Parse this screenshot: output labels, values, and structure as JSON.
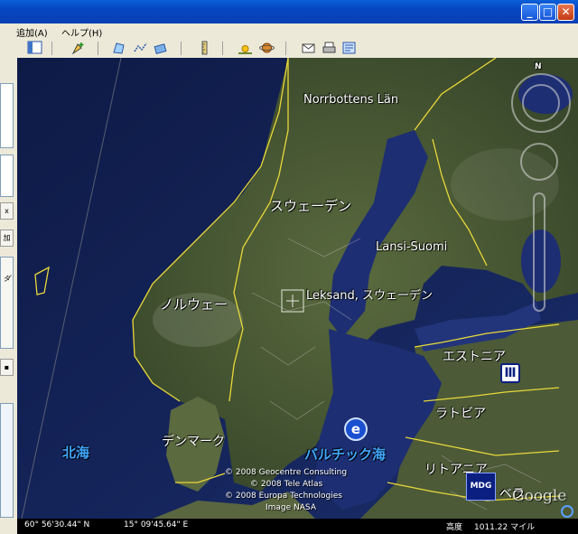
{
  "menu": {
    "items": [
      {
        "label": "追加(A)"
      },
      {
        "label": "ヘルプ(H)"
      }
    ]
  },
  "toolbar": {
    "icons": [
      "sidebar-toggle-icon",
      "placemark-icon",
      "polygon-icon",
      "path-icon",
      "overlay-icon",
      "ruler-icon",
      "sunlight-icon",
      "planet-icon",
      "email-icon",
      "print-icon",
      "map-view-icon"
    ]
  },
  "sidebar": {
    "buttons": [
      {
        "label": "x"
      },
      {
        "label": "加"
      },
      {
        "label": "ダ"
      }
    ]
  },
  "map": {
    "compass_north": "N",
    "labels": {
      "norrbottens": "Norrbottens Län",
      "sweden": "スウェーデン",
      "lansi_suomi": "Lansi-Suomi",
      "norway": "ノルウェー",
      "leksand": "Leksand, スウェーデン",
      "estonia": "エストニア",
      "latvia": "ラトビア",
      "lithuania": "リトアニア",
      "denmark": "デンマーク",
      "north_sea": "北海",
      "baltic_sea": "バルチック海",
      "partial_label": "ベラ"
    },
    "badge_mdg": "MDG",
    "logo": "Google",
    "copyright": [
      "© 2008 Geocentre Consulting",
      "© 2008 Tele Atlas",
      "© 2008 Europa Technologies",
      "Image NASA"
    ],
    "accent_colors": {
      "border": "#e8d83a",
      "water": "#1b2c6e",
      "land": "#4a5a36",
      "sea_label": "#3fa8ff"
    }
  },
  "status": {
    "latitude": "60° 56'30.44\" N",
    "longitude": "15° 09'45.64\" E",
    "altitude_label": "高度",
    "altitude_value": "1011.22 マイル"
  }
}
